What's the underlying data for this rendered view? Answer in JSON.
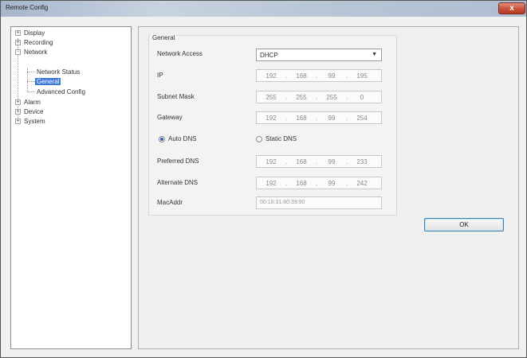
{
  "window": {
    "title": "Remote Config",
    "close_label": "x"
  },
  "tree": {
    "items": [
      {
        "label": "Display",
        "expander": "+"
      },
      {
        "label": "Recording",
        "expander": "+"
      },
      {
        "label": "Network",
        "expander": "-"
      },
      {
        "label": "Network Status"
      },
      {
        "label": "General"
      },
      {
        "label": "Advanced Config"
      },
      {
        "label": "Alarm",
        "expander": "+"
      },
      {
        "label": "Device",
        "expander": "+"
      },
      {
        "label": "System",
        "expander": "+"
      }
    ]
  },
  "general": {
    "title": "General",
    "network_access": {
      "label": "Network Access",
      "value": "DHCP"
    },
    "ip": {
      "label": "IP",
      "octets": [
        "192",
        "168",
        "99",
        "195"
      ]
    },
    "subnet": {
      "label": "Subnet Mask",
      "octets": [
        "255",
        "255",
        "255",
        "0"
      ]
    },
    "gateway": {
      "label": "Gateway",
      "octets": [
        "192",
        "168",
        "99",
        "254"
      ]
    },
    "auto_dns": {
      "label": "Auto DNS",
      "checked": true
    },
    "static_dns": {
      "label": "Static DNS",
      "checked": false
    },
    "preferred_dns": {
      "label": "Preferred DNS",
      "octets": [
        "192",
        "168",
        "99",
        "233"
      ]
    },
    "alternate_dns": {
      "label": "Alternate DNS",
      "octets": [
        "192",
        "168",
        "99",
        "242"
      ]
    },
    "mac": {
      "label": "MacAddr",
      "value": "00:18:31:80:39:90"
    }
  },
  "ok_label": "OK"
}
